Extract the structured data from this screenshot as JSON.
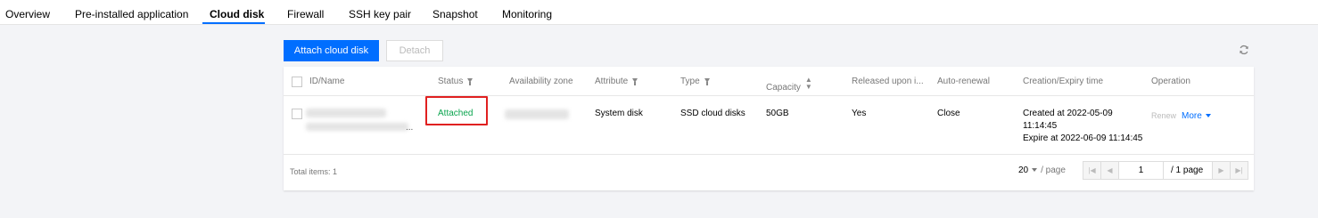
{
  "tabs": {
    "items": [
      {
        "label": "Overview"
      },
      {
        "label": "Pre-installed application"
      },
      {
        "label": "Cloud disk",
        "active": true
      },
      {
        "label": "Firewall"
      },
      {
        "label": "SSH key pair"
      },
      {
        "label": "Snapshot"
      },
      {
        "label": "Monitoring"
      }
    ]
  },
  "toolbar": {
    "attach_label": "Attach cloud disk",
    "detach_label": "Detach",
    "refresh_icon": "refresh-icon"
  },
  "table": {
    "columns": {
      "id_name": "ID/Name",
      "status": "Status",
      "zone": "Availability zone",
      "attribute": "Attribute",
      "type": "Type",
      "capacity": "Capacity",
      "released": "Released upon i...",
      "auto_renewal": "Auto-renewal",
      "creation_expiry": "Creation/Expiry time",
      "operation": "Operation"
    },
    "rows": [
      {
        "id_suffix": "...",
        "status": "Attached",
        "attribute": "System disk",
        "type": "SSD cloud disks",
        "capacity": "50GB",
        "released": "Yes",
        "auto_renewal": "Close",
        "created_line1": "Created at 2022-05-09",
        "created_line2": "11:14:45",
        "expire": "Expire at 2022-06-09 11:14:45",
        "renew": "Renew",
        "more": "More"
      }
    ]
  },
  "footer": {
    "total": "Total items: 1",
    "page_size": "20",
    "page_unit": "/ page",
    "current_page": "1",
    "page_total": "/ 1 page"
  },
  "colors": {
    "accent": "#006eff",
    "status_green": "#0aa44e",
    "highlight_red": "#e02020"
  }
}
